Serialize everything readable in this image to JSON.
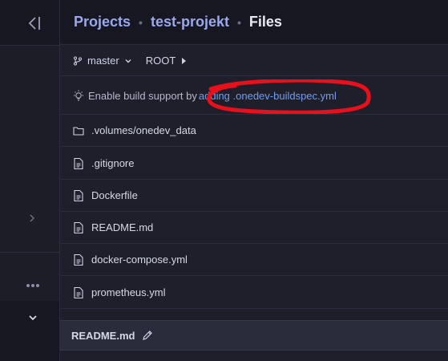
{
  "breadcrumb": {
    "projects": "Projects",
    "project": "test-projekt",
    "current": "Files",
    "separator": "•"
  },
  "branch": {
    "name": "master",
    "path_root": "ROOT"
  },
  "build_hint": {
    "text": "Enable build support by",
    "link": "adding .onedev-buildspec.yml"
  },
  "annotation": {
    "color": "#e8101a"
  },
  "files": [
    {
      "name": ".volumes/onedev_data",
      "icon": "folder-icon"
    },
    {
      "name": ".gitignore",
      "icon": "file-icon"
    },
    {
      "name": "Dockerfile",
      "icon": "file-icon"
    },
    {
      "name": "README.md",
      "icon": "file-icon"
    },
    {
      "name": "docker-compose.yml",
      "icon": "file-icon"
    },
    {
      "name": "prometheus.yml",
      "icon": "file-icon"
    }
  ],
  "readme_panel": {
    "title": "README.md"
  },
  "sidebar": {
    "more_label": "•••"
  }
}
